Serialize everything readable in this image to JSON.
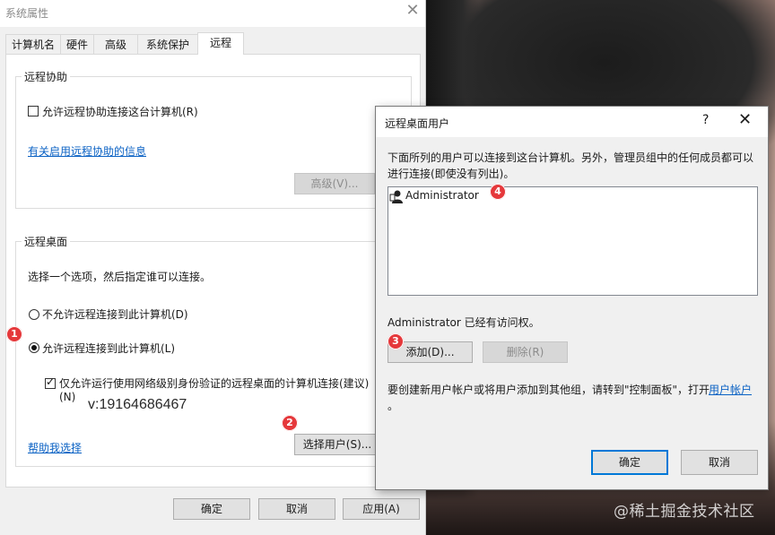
{
  "system_properties": {
    "title": "系统属性",
    "tabs": [
      "计算机名",
      "硬件",
      "高级",
      "系统保护",
      "远程"
    ],
    "active_tab": "远程",
    "remote_assistance": {
      "group_label": "远程协助",
      "allow_checkbox_label": "允许远程协助连接这台计算机(R)",
      "allow_checked": false,
      "info_link": "有关启用远程协助的信息",
      "advanced_button": "高级(V)..."
    },
    "remote_desktop": {
      "group_label": "远程桌面",
      "instruction": "选择一个选项，然后指定谁可以连接。",
      "option_deny": "不允许远程连接到此计算机(D)",
      "option_allow": "允许远程连接到此计算机(L)",
      "selected_option": "allow",
      "nla_label_line1": "仅允许运行使用网络级别身份验证的远程桌面的计算机连接(建议)",
      "nla_label_line2": "(N)",
      "nla_checked": true,
      "help_link": "帮助我选择",
      "select_users_button": "选择用户(S)..."
    },
    "buttons": {
      "ok": "确定",
      "cancel": "取消",
      "apply": "应用(A)"
    }
  },
  "overlay_text": "v:19164686467",
  "annotations": [
    "1",
    "2",
    "3",
    "4"
  ],
  "remote_desktop_users": {
    "title": "远程桌面用户",
    "help_glyph": "?",
    "description_line1": "下面所列的用户可以连接到这台计算机。另外，管理员组中的任何成员都可以",
    "description_line2": "进行连接(即使没有列出)。",
    "users": [
      "Administrator"
    ],
    "access_status": "Administrator 已经有访问权。",
    "add_button": "添加(D)...",
    "remove_button": "删除(R)",
    "info_text_prefix": "要创建新用户帐户或将用户添加到其他组，请转到\"控制面板\"，打开",
    "info_link": "用户帐户",
    "info_text_suffix": "。",
    "ok_button": "确定",
    "cancel_button": "取消"
  },
  "watermark": "@稀土掘金技术社区",
  "colors": {
    "link": "#0b62c4",
    "badge": "#e5383b",
    "default_button_border": "#0078d7"
  }
}
